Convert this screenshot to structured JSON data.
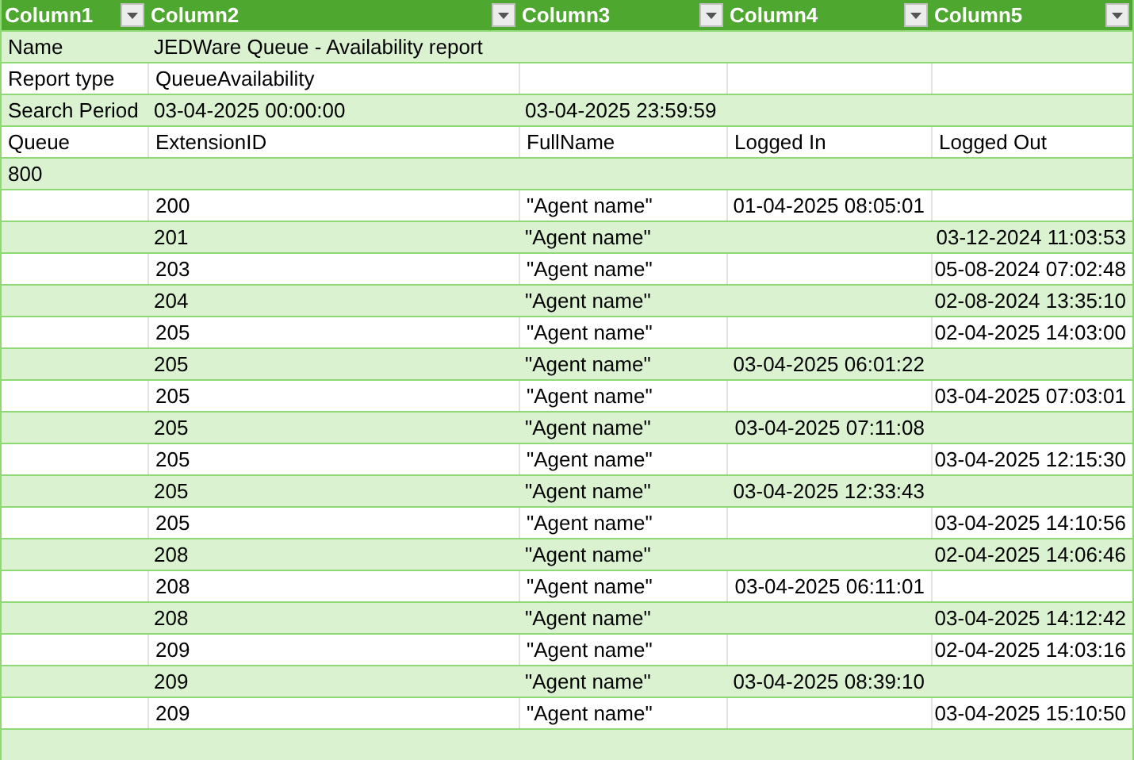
{
  "table": {
    "columns": [
      "Column1",
      "Column2",
      "Column3",
      "Column4",
      "Column5"
    ],
    "rows": [
      {
        "kind": "info",
        "column1": "Name",
        "column2": "JEDWare Queue - Availability report"
      },
      {
        "kind": "info",
        "column1": "Report type",
        "column2": "QueueAvailability"
      },
      {
        "kind": "info",
        "column1": "Search Period",
        "column2": "03-04-2025 00:00:00",
        "column3": "03-04-2025 23:59:59"
      },
      {
        "kind": "info",
        "column1": "Queue",
        "column2": "ExtensionID",
        "column3": "FullName",
        "column4": "Logged In",
        "column5": "Logged Out"
      },
      {
        "kind": "info",
        "column1": "800"
      },
      {
        "kind": "record",
        "column2": "200",
        "column3": "\"Agent name\"",
        "column4": "01-04-2025 08:05:01"
      },
      {
        "kind": "record",
        "column2": "201",
        "column3": "\"Agent name\"",
        "column5": "03-12-2024 11:03:53"
      },
      {
        "kind": "record",
        "column2": "203",
        "column3": "\"Agent name\"",
        "column5": "05-08-2024 07:02:48"
      },
      {
        "kind": "record",
        "column2": "204",
        "column3": "\"Agent name\"",
        "column5": "02-08-2024 13:35:10"
      },
      {
        "kind": "record",
        "column2": "205",
        "column3": "\"Agent name\"",
        "column5": "02-04-2025 14:03:00"
      },
      {
        "kind": "record",
        "column2": "205",
        "column3": "\"Agent name\"",
        "column4": "03-04-2025 06:01:22"
      },
      {
        "kind": "record",
        "column2": "205",
        "column3": "\"Agent name\"",
        "column5": "03-04-2025 07:03:01"
      },
      {
        "kind": "record",
        "column2": "205",
        "column3": "\"Agent name\"",
        "column4": "03-04-2025 07:11:08"
      },
      {
        "kind": "record",
        "column2": "205",
        "column3": "\"Agent name\"",
        "column5": "03-04-2025 12:15:30"
      },
      {
        "kind": "record",
        "column2": "205",
        "column3": "\"Agent name\"",
        "column4": "03-04-2025 12:33:43"
      },
      {
        "kind": "record",
        "column2": "205",
        "column3": "\"Agent name\"",
        "column5": "03-04-2025 14:10:56"
      },
      {
        "kind": "record",
        "column2": "208",
        "column3": "\"Agent name\"",
        "column5": "02-04-2025 14:06:46"
      },
      {
        "kind": "record",
        "column2": "208",
        "column3": "\"Agent name\"",
        "column4": "03-04-2025 06:11:01"
      },
      {
        "kind": "record",
        "column2": "208",
        "column3": "\"Agent name\"",
        "column5": "03-04-2025 14:12:42"
      },
      {
        "kind": "record",
        "column2": "209",
        "column3": "\"Agent name\"",
        "column5": "02-04-2025 14:03:16"
      },
      {
        "kind": "record",
        "column2": "209",
        "column3": "\"Agent name\"",
        "column4": "03-04-2025 08:39:10"
      },
      {
        "kind": "record",
        "column2": "209",
        "column3": "\"Agent name\"",
        "column5": "03-04-2025 15:10:50"
      }
    ]
  }
}
